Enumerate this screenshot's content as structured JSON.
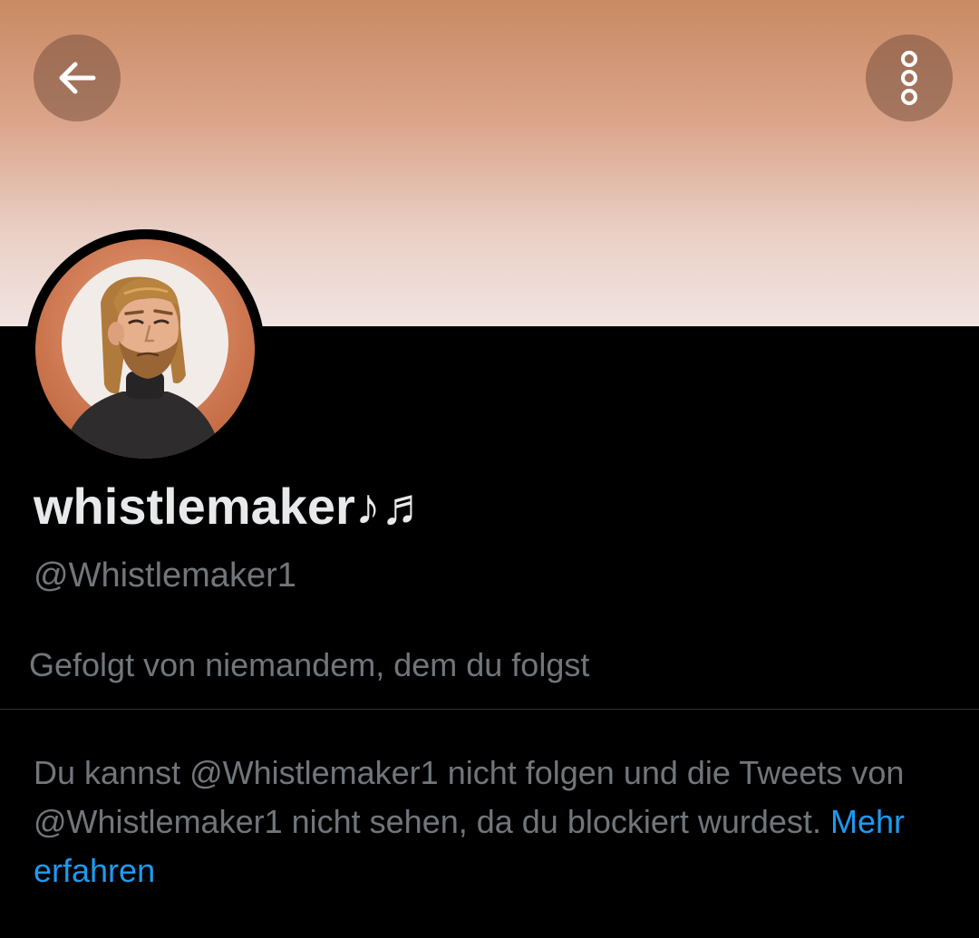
{
  "header": {
    "back_icon": "arrow-left-icon",
    "more_icon": "more-options-icon",
    "banner_colors": [
      "#c98a63",
      "#dca58b",
      "#ead0c6",
      "#f1e4e2"
    ]
  },
  "profile": {
    "display_name": "whistlemaker♪♬",
    "handle": "@Whistlemaker1",
    "followed_by": "Gefolgt von niemandem, dem du folgst"
  },
  "blocked_notice": {
    "text": "Du kannst @Whistlemaker1 nicht folgen und die Tweets von @Whistlemaker1 nicht sehen, da du blockiert wurdest. ",
    "link_label": "Mehr erfahren",
    "link_color": "#1d9bf0"
  }
}
